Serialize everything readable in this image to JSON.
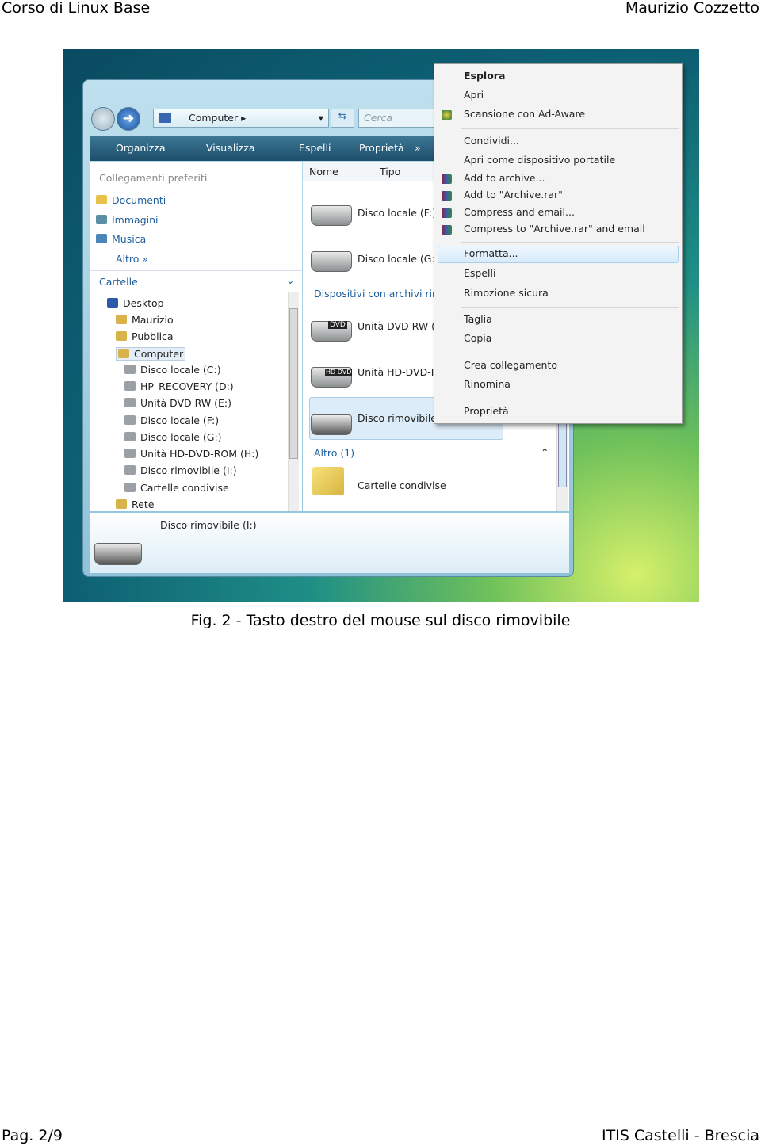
{
  "header": {
    "left": "Corso di Linux Base",
    "right": "Maurizio Cozzetto"
  },
  "footer": {
    "left": "Pag. 2/9",
    "right": "ITIS Castelli - Brescia"
  },
  "caption": "Fig. 2 - Tasto destro del mouse sul disco rimovibile",
  "explorer": {
    "address": "Computer",
    "search_placeholder": "Cerca",
    "toolbar": [
      "Organizza",
      "Visualizza",
      "Espelli",
      "Proprietà",
      "»"
    ],
    "favorites_title": "Collegamenti preferiti",
    "favorites": [
      "Documenti",
      "Immagini",
      "Musica"
    ],
    "more": "Altro »",
    "folders_title": "Cartelle",
    "tree": [
      {
        "label": "Desktop",
        "level": 0
      },
      {
        "label": "Maurizio",
        "level": 1
      },
      {
        "label": "Pubblica",
        "level": 1
      },
      {
        "label": "Computer",
        "level": 1,
        "selected": true
      },
      {
        "label": "Disco locale (C:)",
        "level": 2
      },
      {
        "label": "HP_RECOVERY (D:)",
        "level": 2
      },
      {
        "label": "Unità DVD RW (E:)",
        "level": 2
      },
      {
        "label": "Disco locale (F:)",
        "level": 2
      },
      {
        "label": "Disco locale (G:)",
        "level": 2
      },
      {
        "label": "Unità HD-DVD-ROM (H:)",
        "level": 2
      },
      {
        "label": "Disco rimovibile (I:)",
        "level": 2
      },
      {
        "label": "Cartelle condivise",
        "level": 2
      },
      {
        "label": "Rete",
        "level": 1
      }
    ],
    "columns": [
      "Nome",
      "Tipo"
    ],
    "items": [
      "Disco locale (F:)",
      "Disco locale (G:)"
    ],
    "group_removable": "Dispositivi con archivi rim",
    "removable_items": [
      {
        "label": "Unità DVD RW (E",
        "badge": "DVD"
      },
      {
        "label": "Unità HD-DVD-R",
        "badge": "HD DVD"
      },
      {
        "label": "Disco rimovibile",
        "badge": ""
      }
    ],
    "group_other": "Altro (1)",
    "other_items": [
      "Cartelle condivise"
    ],
    "details_title": "Disco rimovibile (I:)"
  },
  "context_menu": {
    "items": [
      "Esplora",
      "Apri",
      "Scansione con Ad-Aware",
      "Condividi...",
      "Apri come dispositivo portatile",
      "Add to archive...",
      "Add to \"Archive.rar\"",
      "Compress and email...",
      "Compress to \"Archive.rar\" and email",
      "Formatta...",
      "Espelli",
      "Rimozione sicura",
      "Taglia",
      "Copia",
      "Crea collegamento",
      "Rinomina",
      "Proprietà"
    ],
    "highlighted": "Formatta..."
  }
}
